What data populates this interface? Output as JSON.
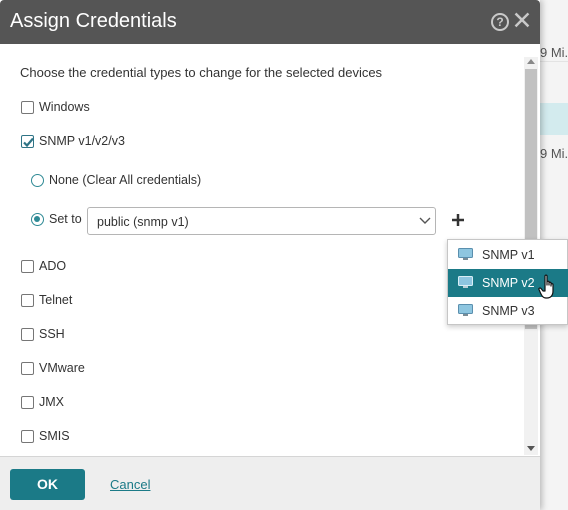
{
  "background": {
    "rows": [
      "9 Mi...",
      "",
      "9 Mi..."
    ]
  },
  "dialog": {
    "title": "Assign Credentials",
    "help_icon": "help-circle-icon",
    "close_icon": "close-icon",
    "intro": "Choose the credential types to change for the selected devices",
    "credentials": [
      {
        "label": "Windows",
        "checked": false
      },
      {
        "label": "SNMP v1/v2/v3",
        "checked": true
      },
      {
        "label": "ADO",
        "checked": false
      },
      {
        "label": "Telnet",
        "checked": false
      },
      {
        "label": "SSH",
        "checked": false
      },
      {
        "label": "VMware",
        "checked": false
      },
      {
        "label": "JMX",
        "checked": false
      },
      {
        "label": "SMIS",
        "checked": false
      }
    ],
    "snmp_options": {
      "none_label": "None (Clear All credentials)",
      "set_to_label": "Set to",
      "selected": "set_to",
      "select_value": "public (snmp v1)"
    },
    "add_icon": "plus-icon",
    "footer": {
      "ok_label": "OK",
      "cancel_label": "Cancel"
    }
  },
  "popup_menu": {
    "items": [
      {
        "label": "SNMP v1",
        "icon": "monitor-icon",
        "highlighted": false
      },
      {
        "label": "SNMP v2",
        "icon": "monitor-icon",
        "highlighted": true
      },
      {
        "label": "SNMP v3",
        "icon": "monitor-icon",
        "highlighted": false
      }
    ]
  },
  "colors": {
    "title_bar": "#555555",
    "accent": "#1b7a87",
    "highlight_row": "#d3ebee"
  }
}
